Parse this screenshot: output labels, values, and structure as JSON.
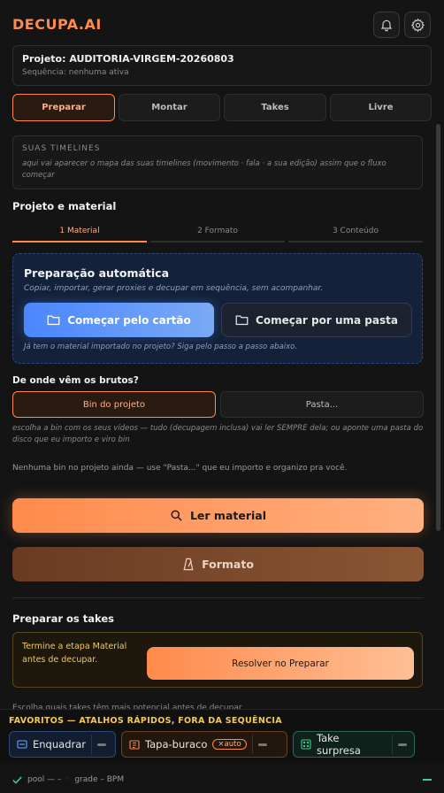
{
  "brand": "DECUPA.AI",
  "project": {
    "title": "Projeto: AUDITORIA-VIRGEM-20260803",
    "sequence": "Sequência: nenhuma ativa"
  },
  "main_tabs": [
    {
      "label": "Preparar",
      "active": true
    },
    {
      "label": "Montar",
      "active": false
    },
    {
      "label": "Takes",
      "active": false
    },
    {
      "label": "Livre",
      "active": false
    }
  ],
  "timelines": {
    "label": "SUAS TIMELINES",
    "description": "aqui vai aparecer o mapa das suas timelines (movimento · fala · a sua edição) assim que o fluxo começar"
  },
  "material_section": {
    "title": "Projeto e material",
    "steps": [
      "1 Material",
      "2 Formato",
      "3 Conteúdo"
    ]
  },
  "auto_prep": {
    "title": "Preparação automática",
    "subtitle": "Copiar, importar, gerar proxies e decupar em sequência, sem acompanhar.",
    "primary_button": "Começar pelo cartão",
    "secondary_button": "Começar por uma pasta",
    "note": "Já tem o material importado no projeto? Siga pelo passo a passo abaixo."
  },
  "source": {
    "question": "De onde vêm os brutos?",
    "options": [
      "Bin do projeto",
      "Pasta..."
    ],
    "help": "escolha a bin com os seus vídeos — tudo (decupagem inclusa) vai ler SEMPRE dela; ou aponte uma pasta do disco que eu importo e viro bin",
    "empty": "Nenhuma bin no projeto ainda — use \"Pasta...\" que eu importo e organizo pra você."
  },
  "actions": {
    "read_material": "Ler material",
    "format": "Formato"
  },
  "takes_prep": {
    "title": "Preparar os takes",
    "warning": "Termine a etapa Material antes de decupar.",
    "resolve_button": "Resolver no Preparar"
  },
  "peek_text": "Escolha quais takes têm mais potencial antes de decupar",
  "favorites": {
    "title": "FAVORITOS — ATALHOS RÁPIDOS, FORA DA SEQUÊNCIA",
    "items": [
      {
        "label": "Enquadrar"
      },
      {
        "label": "Tapa-buraco",
        "tag": "×auto"
      },
      {
        "label": "Take surpresa"
      }
    ]
  },
  "status": {
    "pool": "pool — –",
    "grade": "grade – BPM"
  },
  "colors": {
    "accent": "#ff8a4c",
    "blue": "#4a86ff",
    "warning": "#f4c95d",
    "green": "#3ccf8e"
  }
}
